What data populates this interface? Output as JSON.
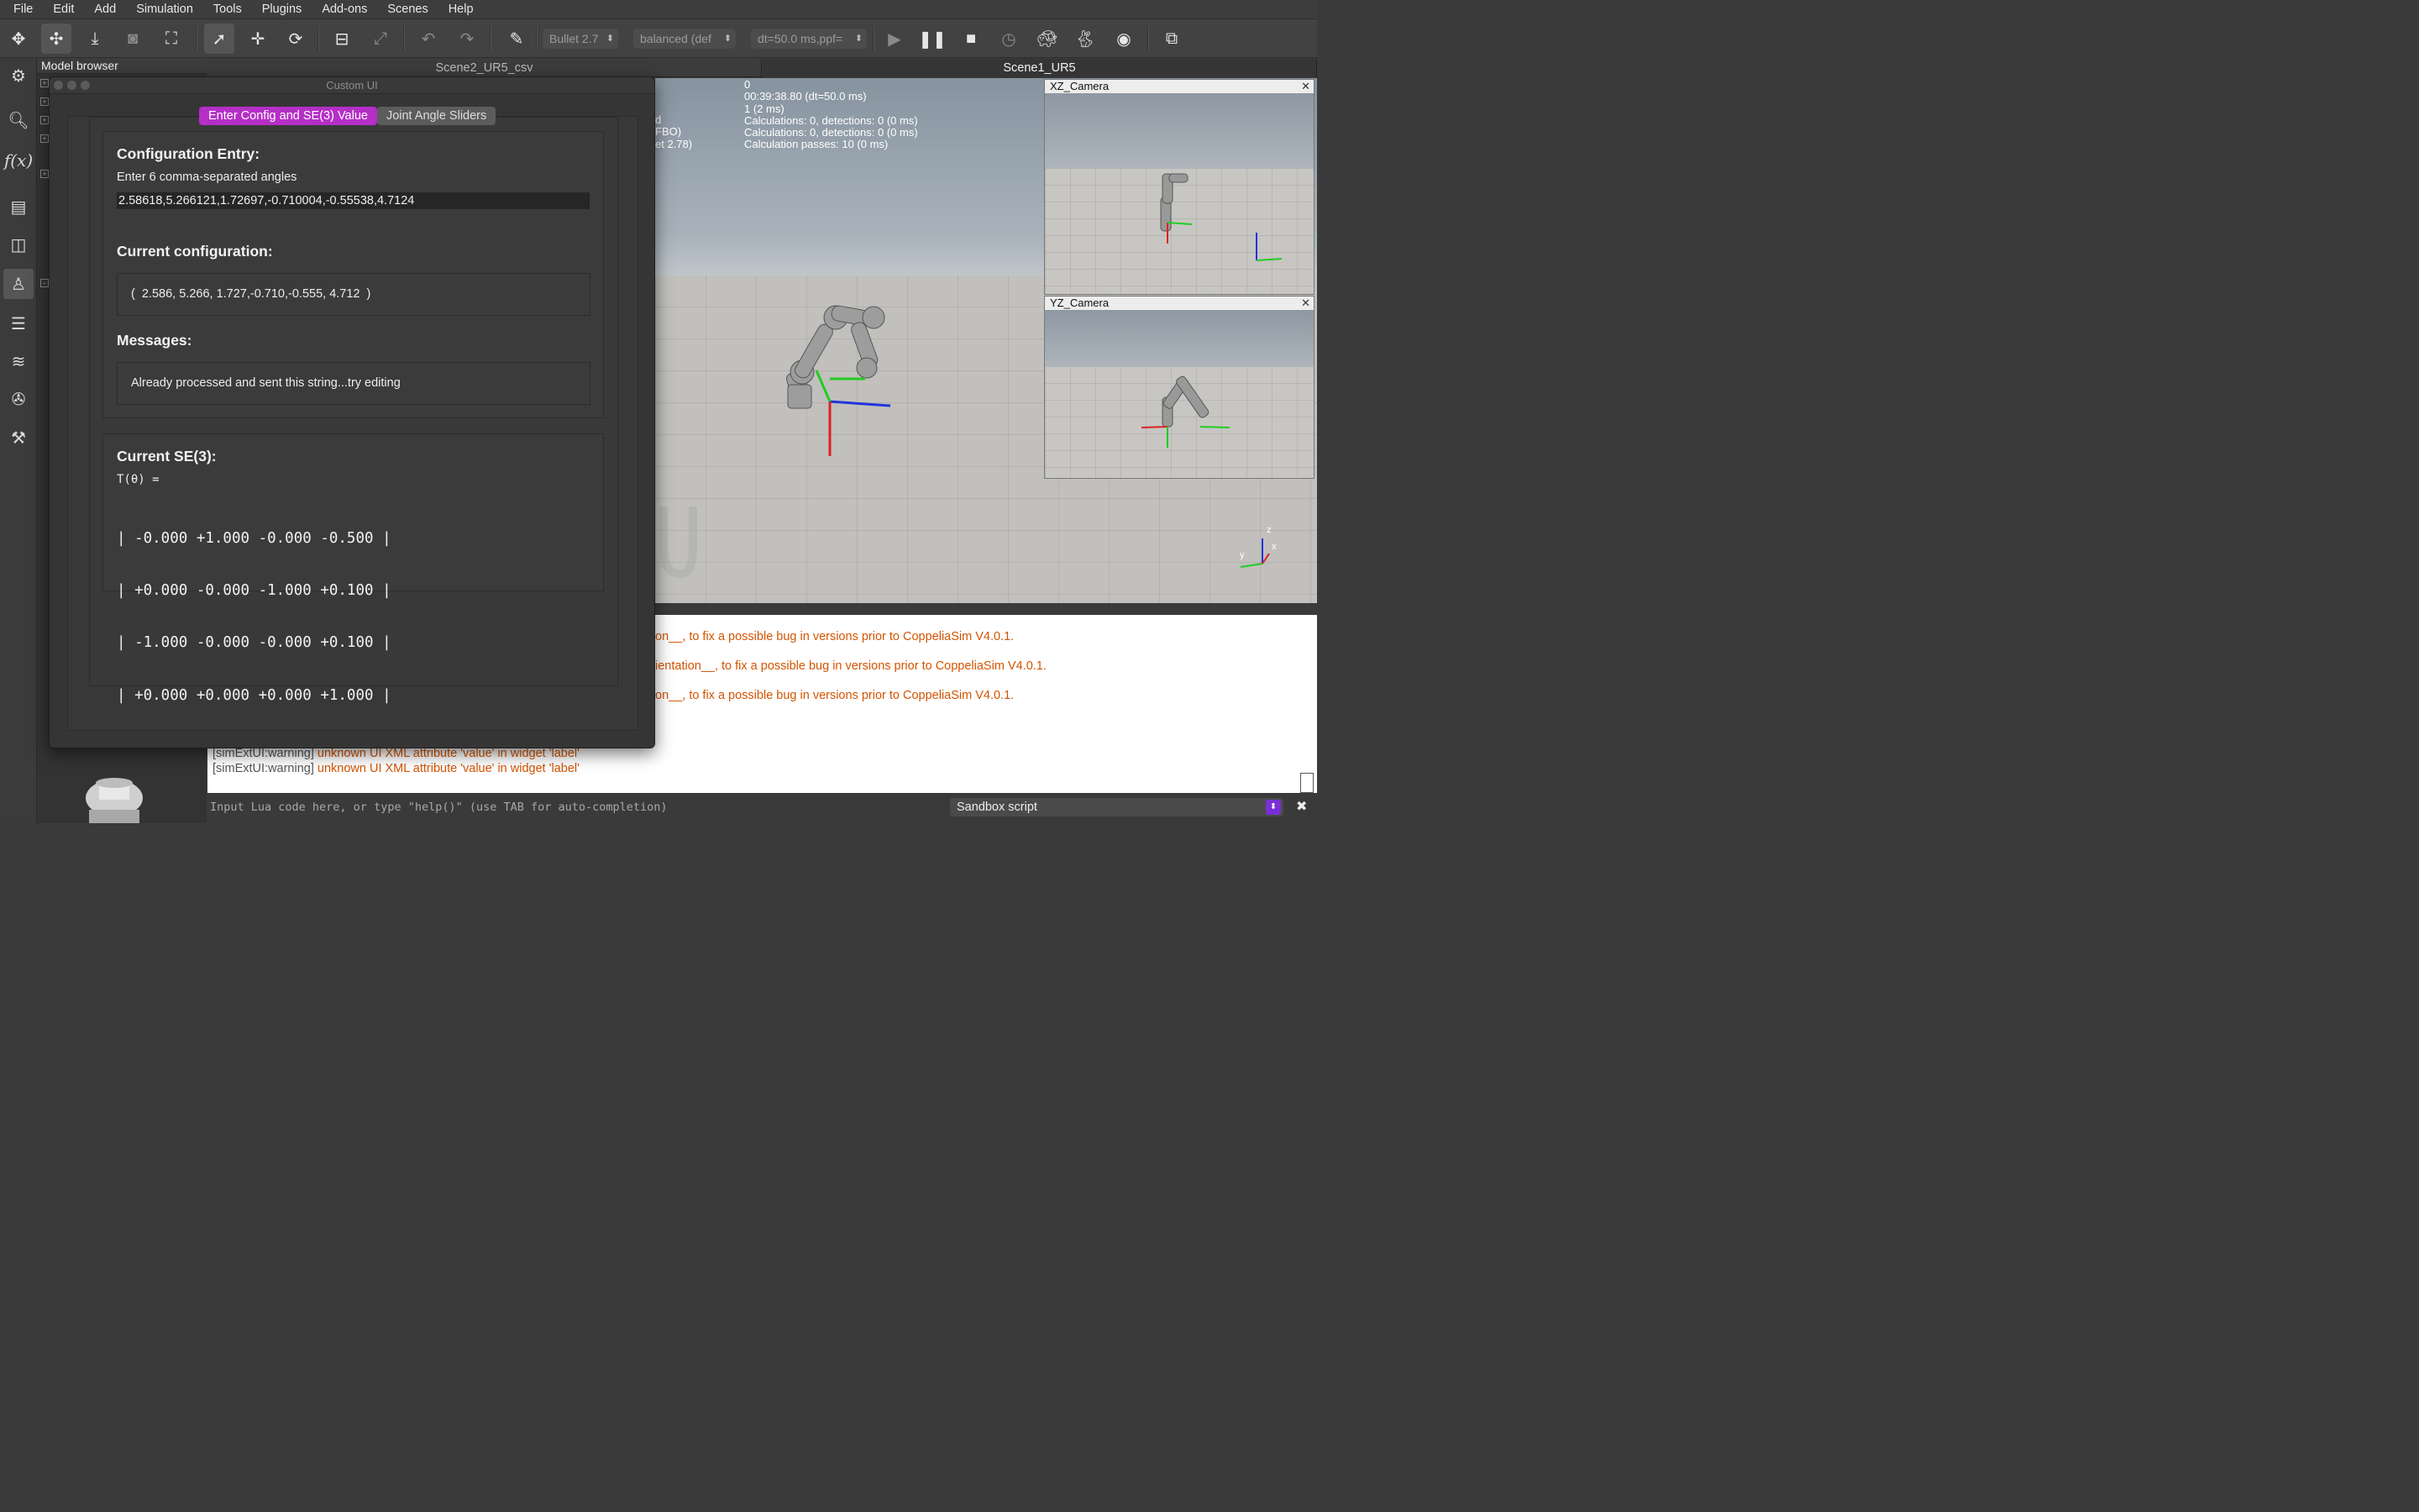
{
  "menubar": {
    "items": [
      "File",
      "Edit",
      "Add",
      "Simulation",
      "Tools",
      "Plugins",
      "Add-ons",
      "Scenes",
      "Help"
    ]
  },
  "toolbar": {
    "engine": "Bullet 2.7",
    "accuracy": "balanced (def",
    "timestep": "dt=50.0 ms,ppf=",
    "icons": [
      "move-icon",
      "rotate-icon",
      "shift-down-icon",
      "camera-icon",
      "fit-view-icon",
      "click-select-icon",
      "object-shift-icon",
      "object-rotate-icon",
      "assemble-icon",
      "transfer-icon",
      "undo-icon",
      "redo-icon",
      "brush-icon",
      "play-icon",
      "pause-icon",
      "stop-icon",
      "real-time-icon",
      "slow-down-icon",
      "speed-up-icon",
      "visualization-icon",
      "page-selector-icon"
    ]
  },
  "model_browser": {
    "title": "Model browser"
  },
  "scene_tabs": [
    "Scene2_UR5_csv",
    "Scene1_UR5"
  ],
  "viewport_info": {
    "left_fragments": [
      "d",
      "FBO)",
      "et 2.78)"
    ],
    "right_lines": [
      "0",
      "00:39:38.80 (dt=50.0 ms)",
      "1 (2 ms)",
      "Calculations: 0, detections: 0 (0 ms)",
      "Calculations: 0, detections: 0 (0 ms)",
      "Calculation passes: 10 (0 ms)"
    ]
  },
  "floating_views": [
    {
      "title": "XZ_Camera"
    },
    {
      "title": "YZ_Camera"
    }
  ],
  "axis_labels": {
    "z": "z",
    "y": "y",
    "x": "x"
  },
  "console": {
    "warnings": [
      "on__, to fix a possible bug in versions prior to CoppeliaSim V4.0.1.",
      "ientation__, to fix a possible bug in versions prior to CoppeliaSim V4.0.1.",
      "on__, to fix a possible bug in versions prior to CoppeliaSim V4.0.1."
    ],
    "log": [
      {
        "tag": "[simExtUI:warning]",
        "msg": "unknown UI XML attribute 'value' in widget 'label'"
      },
      {
        "tag": "[simExtUI:warning]",
        "msg": "unknown UI XML attribute 'value' in widget 'label'"
      }
    ]
  },
  "command_line": {
    "placeholder": "Input Lua code here, or type \"help()\" (use TAB for auto-completion)"
  },
  "script_selector": {
    "value": "Sandbox script"
  },
  "dialog": {
    "title": "Custom UI",
    "tabs": [
      "Enter Config and SE(3) Value",
      "Joint Angle Sliders"
    ],
    "config_entry": {
      "heading": "Configuration Entry:",
      "instruction": "Enter 6 comma-separated angles",
      "value": "2.58618,5.266121,1.72697,-0.710004,-0.55538,4.7124"
    },
    "current_config": {
      "heading": "Current configuration:",
      "value": "(  2.586, 5.266, 1.727,-0.710,-0.555, 4.712  )"
    },
    "messages": {
      "heading": "Messages:",
      "value": "Already processed and sent this string...try editing"
    },
    "se3": {
      "heading": "Current SE(3):",
      "label": "T(θ) =",
      "rows": [
        "| -0.000 +1.000 -0.000 -0.500 |",
        "| +0.000 -0.000 -1.000 +0.100 |",
        "| -1.000 -0.000 -0.000 +0.100 |",
        "| +0.000 +0.000 +0.000 +1.000 |"
      ]
    }
  }
}
